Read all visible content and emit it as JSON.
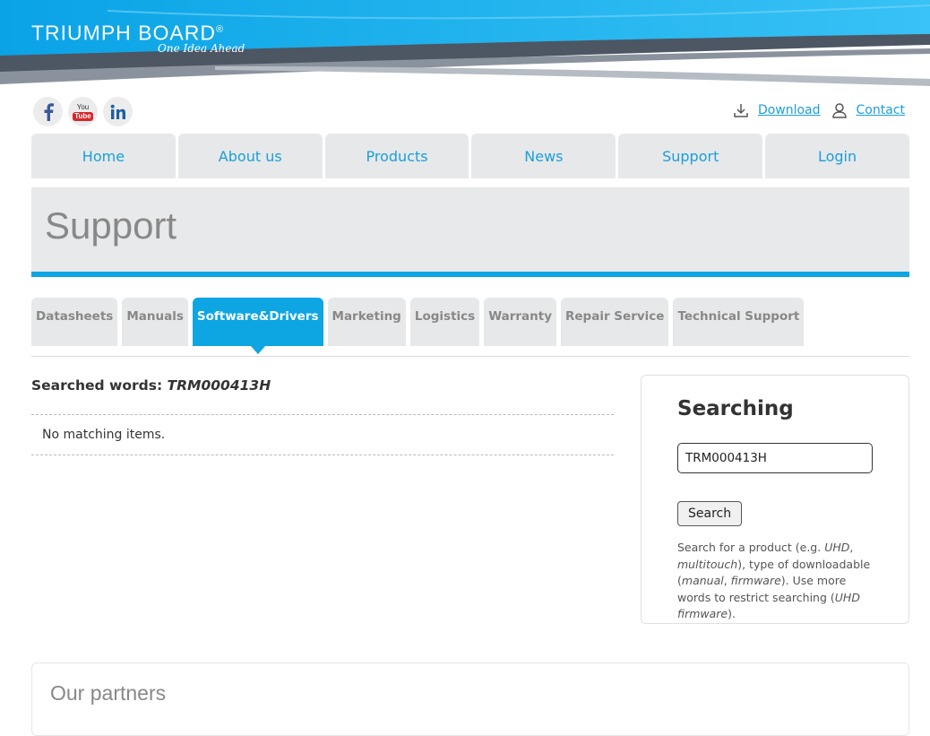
{
  "logo": {
    "name": "TRIUMPH BOARD",
    "reg": "®",
    "tagline": "One Idea Ahead"
  },
  "social": [
    {
      "icon": "facebook-icon"
    },
    {
      "icon": "youtube-icon",
      "text1": "You",
      "text2": "Tube"
    },
    {
      "icon": "linkedin-icon"
    }
  ],
  "toplinks": {
    "download": "Download",
    "contact": "Contact"
  },
  "nav": [
    "Home",
    "About us",
    "Products",
    "News",
    "Support",
    "Login"
  ],
  "page_title": "Support",
  "subtabs": [
    "Datasheets",
    "Manuals",
    "Software&Drivers",
    "Marketing",
    "Logistics",
    "Warranty",
    "Repair Service",
    "Technical Support"
  ],
  "active_subtab": "Software&Drivers",
  "search_result": {
    "label": "Searched words:",
    "term": "TRM000413H",
    "empty_message": "No matching items."
  },
  "search_box": {
    "title": "Searching",
    "value": "TRM000413H",
    "button": "Search",
    "hint_parts": [
      "Search for a product (e.g. ",
      "UHD",
      ", ",
      "multitouch",
      "), type of downloadable (",
      "manual",
      ", ",
      "firmware",
      "). Use more words to restrict searching (",
      "UHD firmware",
      ")."
    ]
  },
  "partners_title": "Our partners",
  "colors": {
    "accent": "#0ea5e3",
    "link": "#1a9fd9",
    "tab_bg": "#e7e8ea",
    "banner_dark": "#505a66"
  }
}
